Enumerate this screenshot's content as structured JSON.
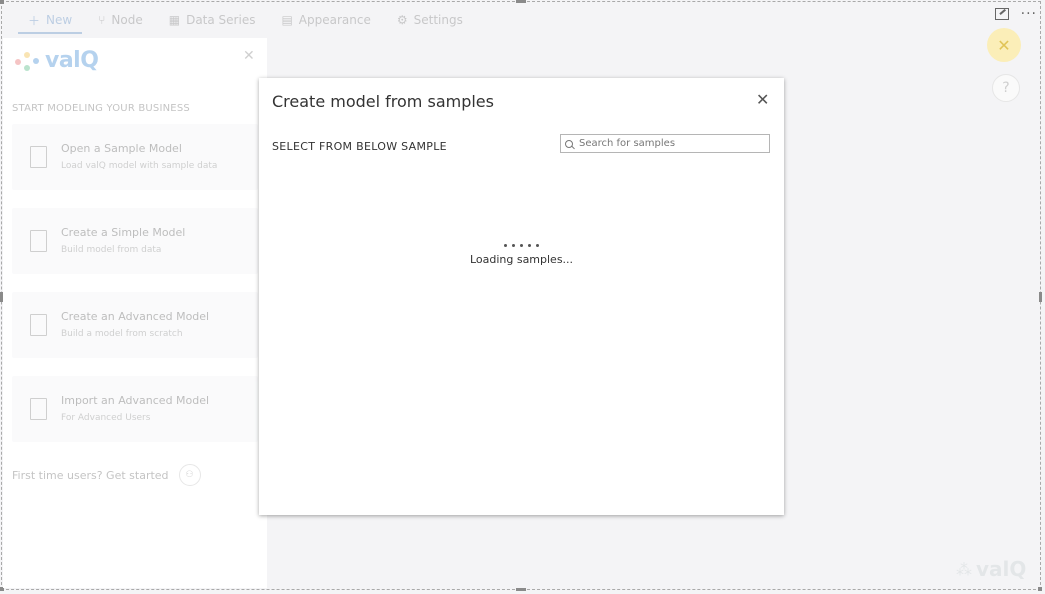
{
  "toolbar": {
    "tabs": [
      {
        "label": "New",
        "icon": "plus-icon",
        "active": true
      },
      {
        "label": "Node",
        "icon": "node-icon"
      },
      {
        "label": "Data Series",
        "icon": "data-series-icon"
      },
      {
        "label": "Appearance",
        "icon": "appearance-icon"
      },
      {
        "label": "Settings",
        "icon": "gear-icon"
      }
    ],
    "more": "···"
  },
  "close_button": {
    "glyph": "✕",
    "color": "#fbeeb8"
  },
  "help_button": {
    "glyph": "?"
  },
  "left_panel": {
    "logo_text": "valQ",
    "close_glyph": "✕",
    "heading": "START MODELING YOUR BUSINESS",
    "cards": [
      {
        "title": "Open a Sample Model",
        "subtitle": "Load valQ model with sample data",
        "icon": "chart-document-icon"
      },
      {
        "title": "Create a Simple Model",
        "subtitle": "Build model from data",
        "icon": "shapes-icon"
      },
      {
        "title": "Create an Advanced Model",
        "subtitle": "Build a model from scratch",
        "icon": "new-document-icon"
      },
      {
        "title": "Import an Advanced Model",
        "subtitle": "For Advanced Users",
        "icon": "import-document-icon"
      }
    ],
    "first_time_text": "First time users? Get started"
  },
  "modal": {
    "title": "Create model from samples",
    "close_glyph": "✕",
    "subtitle": "SELECT FROM BELOW SAMPLE",
    "search_placeholder": "Search for samples",
    "loading_text": "Loading samples..."
  },
  "watermark_text": "valQ",
  "colors": {
    "accent": "#2f6db5",
    "logo_blue": "#2f7fd0",
    "close_yellow": "#fbeeb8"
  }
}
